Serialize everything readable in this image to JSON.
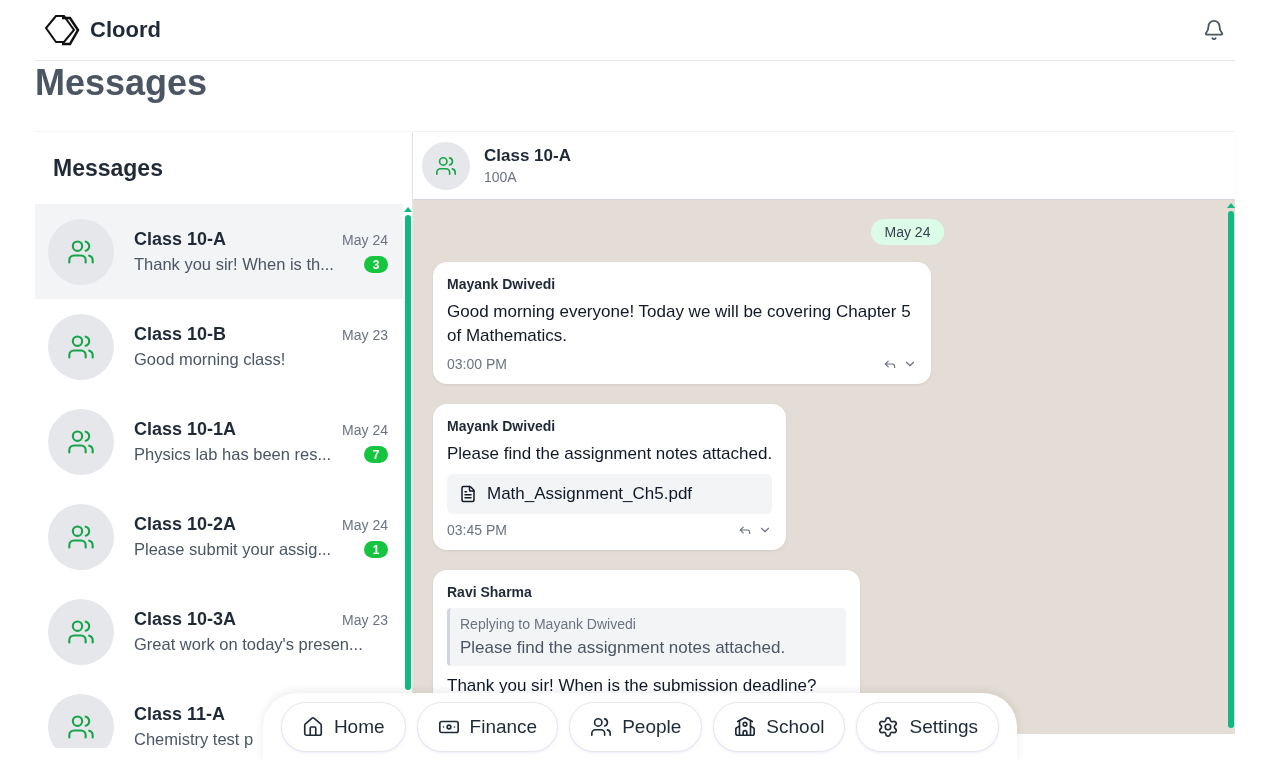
{
  "app": {
    "name": "Cloord"
  },
  "page_title": "Messages",
  "sidebar": {
    "title": "Messages",
    "conversations": [
      {
        "name": "Class 10-A",
        "date": "May 24",
        "preview": "Thank you sir! When is th...",
        "unread": "3",
        "selected": true
      },
      {
        "name": "Class 10-B",
        "date": "May 23",
        "preview": "Good morning class!",
        "selected": false
      },
      {
        "name": "Class 10-1A",
        "date": "May 24",
        "preview": "Physics lab has been res...",
        "unread": "7",
        "selected": false
      },
      {
        "name": "Class 10-2A",
        "date": "May 24",
        "preview": "Please submit your assig...",
        "unread": "1",
        "selected": false
      },
      {
        "name": "Class 10-3A",
        "date": "May 23",
        "preview": "Great work on today's presen...",
        "selected": false
      },
      {
        "name": "Class 11-A",
        "preview": "Chemistry test p",
        "selected": false
      }
    ]
  },
  "chat": {
    "title": "Class 10-A",
    "subtitle": "100A",
    "date_divider": "May 24",
    "messages": [
      {
        "kind": "text",
        "sender": "Mayank Dwivedi",
        "text": "Good morning everyone! Today we will be covering Chapter 5 of Mathematics.",
        "time": "03:00 PM"
      },
      {
        "kind": "attachment",
        "sender": "Mayank Dwivedi",
        "text": "Please find the assignment notes attached.",
        "file": "Math_Assignment_Ch5.pdf",
        "time": "03:45 PM"
      },
      {
        "kind": "reply",
        "sender": "Ravi Sharma",
        "reply_to": "Replying to Mayank Dwivedi",
        "quoted": "Please find the assignment notes attached.",
        "text": "Thank you sir! When is the submission deadline?"
      }
    ]
  },
  "nav": [
    {
      "label": "Home"
    },
    {
      "label": "Finance"
    },
    {
      "label": "People"
    },
    {
      "label": "School"
    },
    {
      "label": "Settings"
    }
  ]
}
